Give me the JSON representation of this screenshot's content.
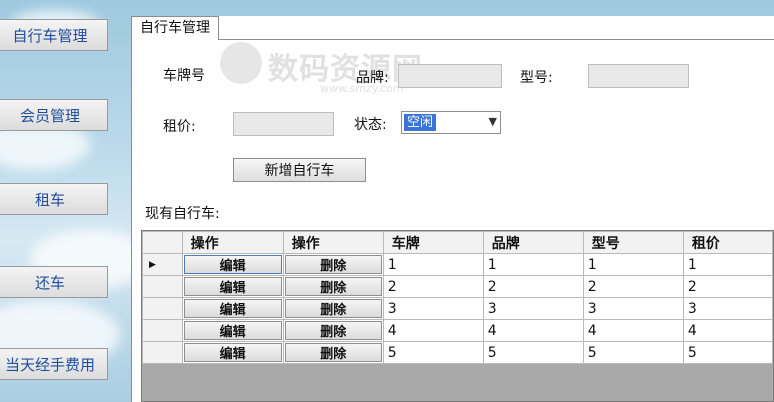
{
  "sidebar": {
    "items": [
      {
        "label": "自行车管理"
      },
      {
        "label": "会员管理"
      },
      {
        "label": "租车"
      },
      {
        "label": "还车"
      },
      {
        "label": "当天经手费用"
      }
    ]
  },
  "tab": {
    "label": "自行车管理"
  },
  "form": {
    "plate_label": "车牌号",
    "brand_label": "品牌:",
    "model_label": "型号:",
    "price_label": "租价:",
    "status_label": "状态:",
    "status_value": "空闲",
    "add_button": "新增自行车"
  },
  "watermark": {
    "title": "数码资源网",
    "url": "www.smzy.com"
  },
  "list_label": "现有自行车:",
  "grid": {
    "columns": [
      "操作",
      "操作",
      "车牌",
      "品牌",
      "型号",
      "租价"
    ],
    "edit_label": "编辑",
    "delete_label": "删除",
    "rows": [
      {
        "plate": "1",
        "brand": "1",
        "model": "1",
        "price": "1"
      },
      {
        "plate": "2",
        "brand": "2",
        "model": "2",
        "price": "2"
      },
      {
        "plate": "3",
        "brand": "3",
        "model": "3",
        "price": "3"
      },
      {
        "plate": "4",
        "brand": "4",
        "model": "4",
        "price": "4"
      },
      {
        "plate": "5",
        "brand": "5",
        "model": "5",
        "price": "5"
      }
    ],
    "current_row_marker": "▶"
  }
}
